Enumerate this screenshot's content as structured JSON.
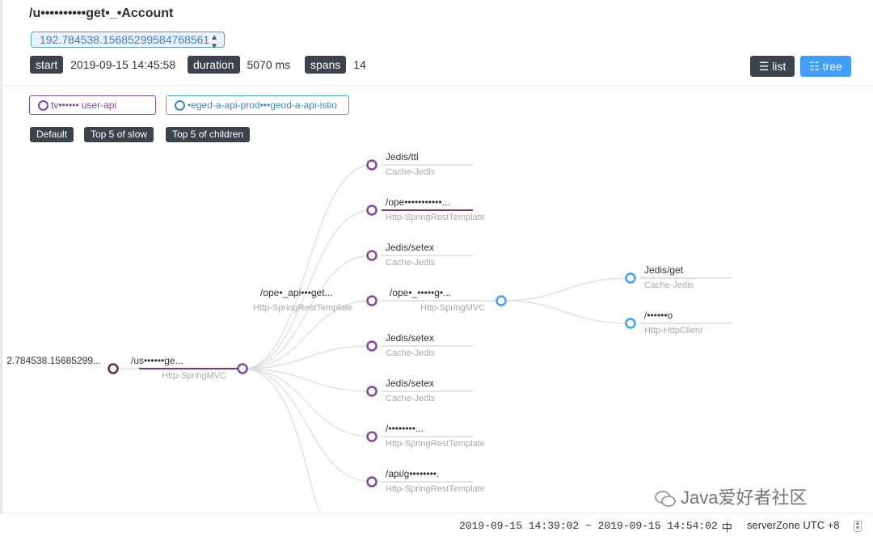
{
  "header": {
    "title": "/u••••••••••get•_•Account",
    "trace_id": "192.784538.15685299584768561",
    "start_label": "start",
    "start_value": "2019-09-15 14:45:58",
    "duration_label": "duration",
    "duration_value": "5070 ms",
    "spans_label": "spans",
    "spans_value": "14"
  },
  "view_toggle": {
    "list_label": "list",
    "tree_label": "tree",
    "active": "tree"
  },
  "services": [
    {
      "label": "tv•••••• user-api",
      "color": "#7e4aa3"
    },
    {
      "label": "•eged-a-api-prod•••geod-a-api-istio",
      "color": "#4aa0d8"
    }
  ],
  "modes": [
    "Default",
    "Top 5 of slow",
    "Top 5 of children"
  ],
  "root": {
    "label": "2.784538.15685299..."
  },
  "nodes": [
    {
      "label": "/us••••••ge...",
      "sub": "Http-SpringMVC"
    },
    {
      "label": "Jedis/ttl",
      "sub": "Cache-Jedis"
    },
    {
      "label": "/ope•••••••••••...",
      "sub": "Http-SpringRestTemplate"
    },
    {
      "label": "Jedis/setex",
      "sub": "Cache-Jedis"
    },
    {
      "label": "/ope•_api•••get...",
      "sub": "Http-SpringRestTemplate"
    },
    {
      "label": "Jedis/setex",
      "sub": "Cache-Jedis"
    },
    {
      "label": "Jedis/setex",
      "sub": "Cache-Jedis"
    },
    {
      "label": "/••••••••...",
      "sub": "Http-SpringRestTemplate"
    },
    {
      "label": "/api/g••••••••.",
      "sub": "Http-SpringRestTemplate"
    },
    {
      "label": "/ope•_•••••g•...",
      "sub": "Http-SpringMVC"
    },
    {
      "label": "Jedis/get",
      "sub": "Cache-Jedis"
    },
    {
      "label": "/••••••o",
      "sub": "Http-HttpClient"
    }
  ],
  "footer": {
    "time_range": "2019-09-15 14:39:02 ~ 2019-09-15 14:54:02",
    "lang": "中",
    "server_zone": "serverZone UTC +8"
  },
  "watermark": "Java爱好者社区",
  "colors": {
    "service_a": "#7e4aa3",
    "service_b": "#409eff",
    "root_node": "#6b2a3a",
    "accent": "#409eff"
  }
}
